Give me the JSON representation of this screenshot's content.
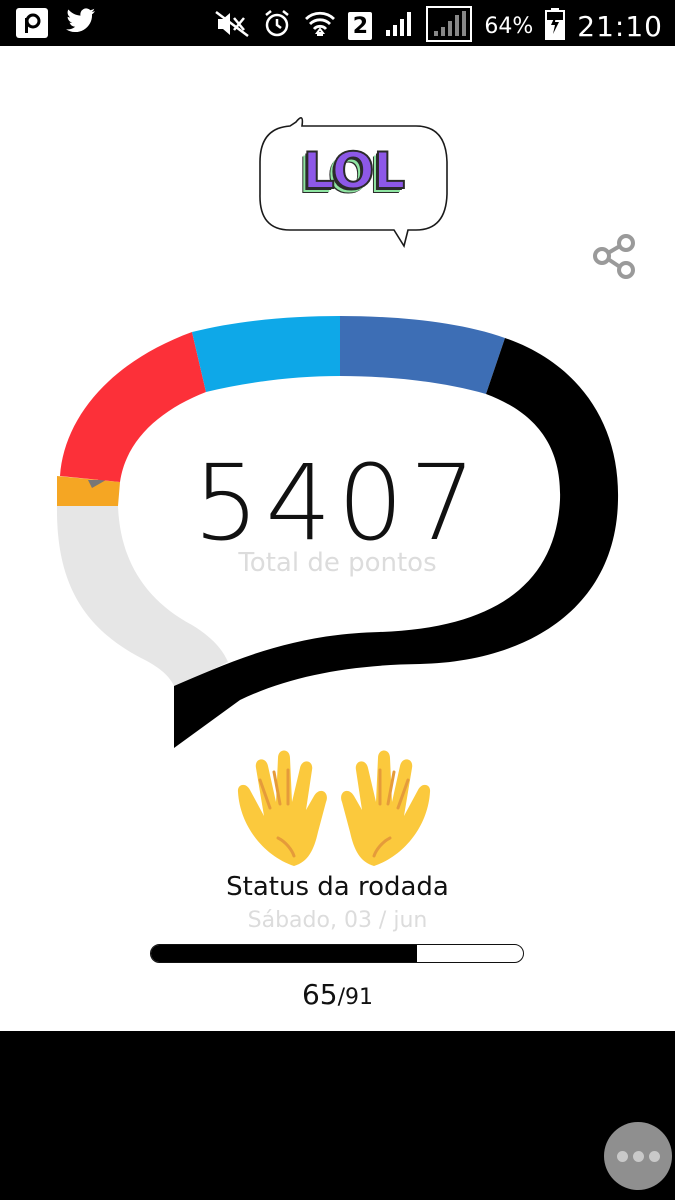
{
  "status_bar": {
    "battery_percent": "64%",
    "time": "21:10",
    "sim_slot": "2",
    "left_icons": [
      "app-p-icon",
      "twitter-icon"
    ],
    "right_icons": [
      "mute-icon",
      "alarm-icon",
      "wifi-icon",
      "sim-2-icon",
      "signal-icon",
      "signal-empty-icon",
      "battery-charging-icon"
    ]
  },
  "header": {
    "sticker_text": "LOL",
    "share_icon": "share-icon"
  },
  "score": {
    "total_value": "5407",
    "total_label": "Total de pontos",
    "segment_colors": [
      "#e6e6e6",
      "#f5a623",
      "#fc3039",
      "#0ea8e8",
      "#3d6eb5",
      "#000000"
    ]
  },
  "round": {
    "title": "Status da rodada",
    "date": "Sábado, 03 / jun",
    "progress_fraction": 0.714,
    "current": "65",
    "separator": "/",
    "total": "91"
  },
  "fab": {
    "icon": "more-dots-icon"
  }
}
